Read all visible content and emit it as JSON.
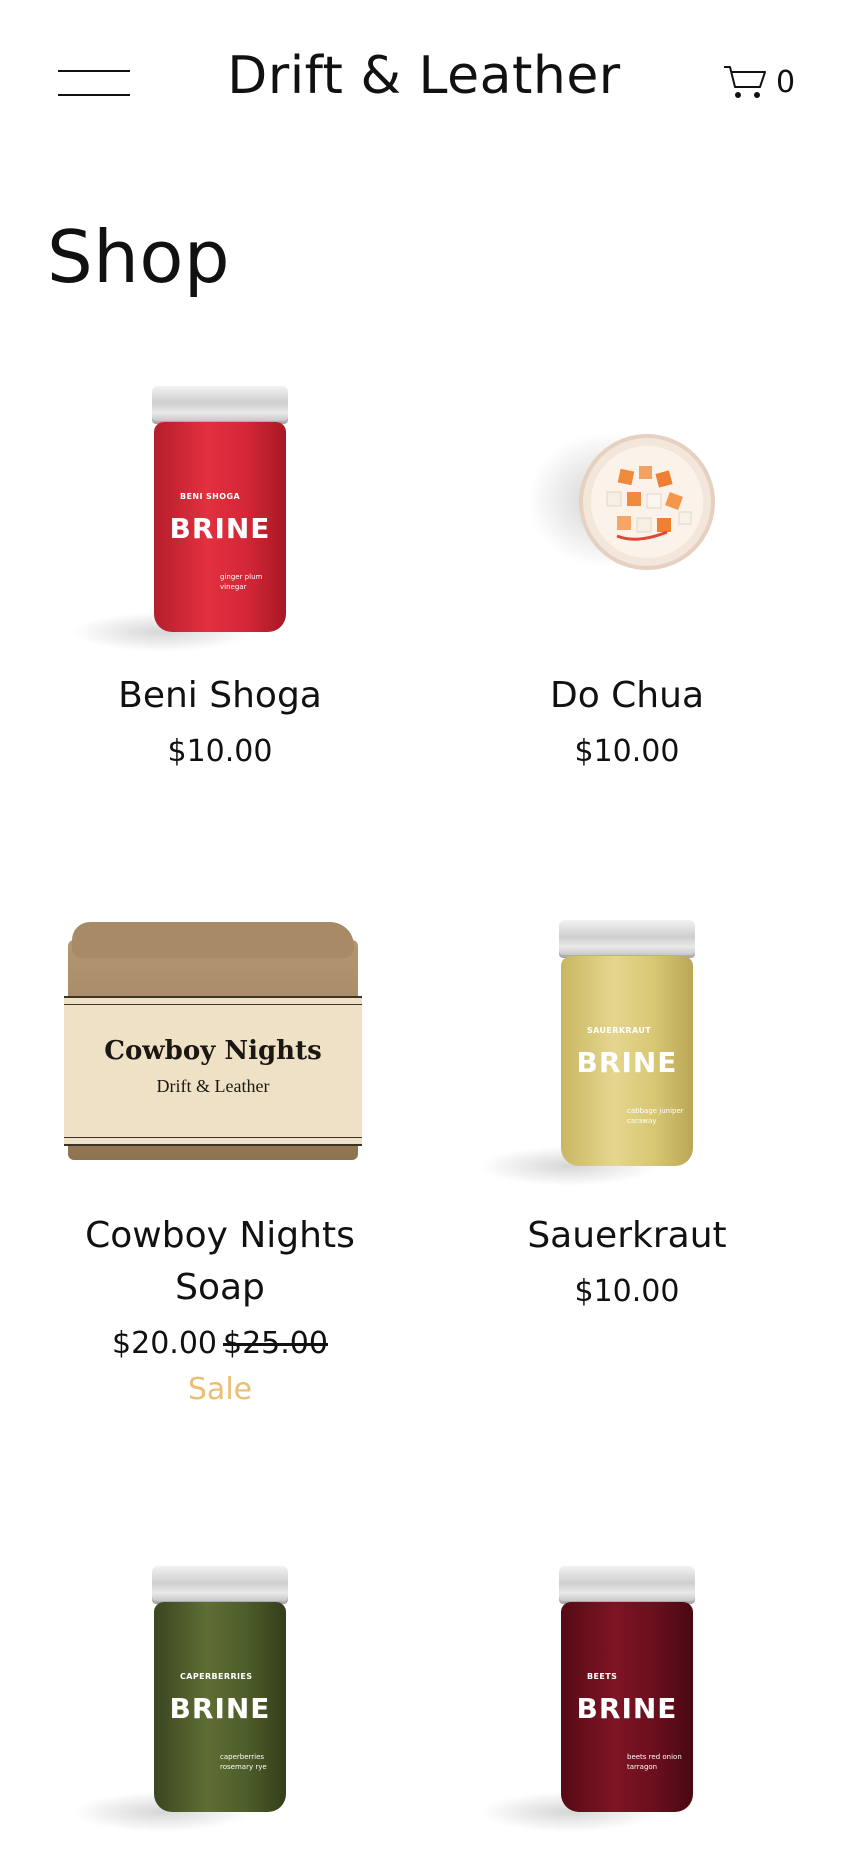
{
  "header": {
    "brand": "Drift & Leather",
    "cart_count": "0"
  },
  "page": {
    "title": "Shop"
  },
  "products": [
    {
      "name": "Beni Shoga",
      "price": "$10.00",
      "jar": {
        "variety": "BENI SHOGA",
        "brand": "BRINE",
        "notes": "ginger plum vinegar",
        "color": "#d6283a"
      }
    },
    {
      "name": "Do Chua",
      "price": "$10.00"
    },
    {
      "name": "Cowboy Nights Soap",
      "price": "$20.00",
      "original_price": "$25.00",
      "badge": "Sale",
      "soap": {
        "title": "Cowboy Nights",
        "brand": "Drift & Leather"
      }
    },
    {
      "name": "Sauerkraut",
      "price": "$10.00",
      "jar": {
        "variety": "SAUERKRAUT",
        "brand": "BRINE",
        "notes": "cabbage juniper caraway",
        "color": "#d7c878"
      }
    },
    {
      "name": "",
      "price": "",
      "jar": {
        "variety": "CAPERBERRIES",
        "brand": "BRINE",
        "notes": "caperberries rosemary rye",
        "color": "#4b5a2a"
      }
    },
    {
      "name": "",
      "price": "",
      "jar": {
        "variety": "BEETS",
        "brand": "BRINE",
        "notes": "beets red onion tarragon",
        "color": "#6d0f1d"
      }
    }
  ],
  "colors": {
    "sale": "#e8bf74",
    "text": "#111111",
    "background": "#ffffff"
  }
}
